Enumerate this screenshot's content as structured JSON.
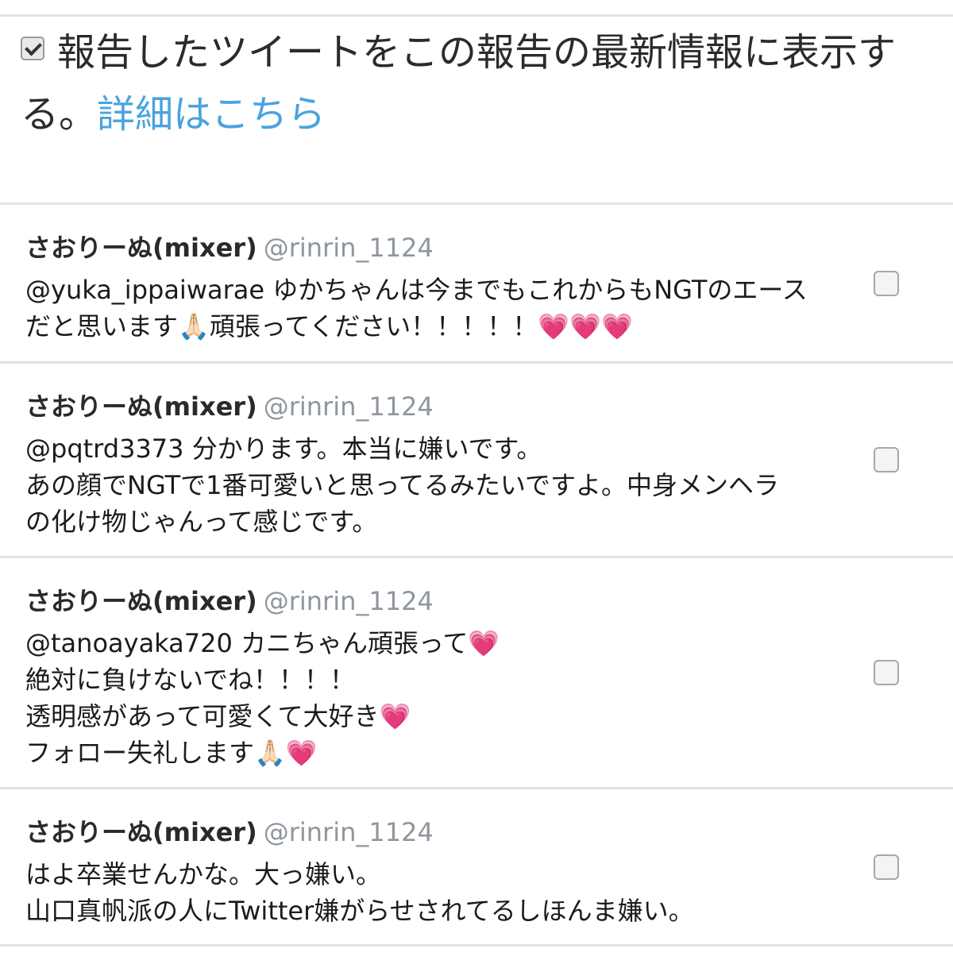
{
  "option": {
    "checked": true,
    "text": "報告したツイートをこの報告の最新情報に表示する。",
    "link": "詳細はこちら"
  },
  "tweets": [
    {
      "name": "さおりーぬ(mixer)",
      "handle": "@rinrin_1124",
      "text": "@yuka_ippaiwarae ゆかちゃんは今までもこれからもNGTのエース\nだと思います🙏🏻頑張ってください！！！！！💗💗💗"
    },
    {
      "name": "さおりーぬ(mixer)",
      "handle": "@rinrin_1124",
      "text": "@pqtrd3373 分かります。本当に嫌いです。\nあの顔でNGTで1番可愛いと思ってるみたいですよ。中身メンヘラ\nの化け物じゃんって感じです。"
    },
    {
      "name": "さおりーぬ(mixer)",
      "handle": "@rinrin_1124",
      "text": "@tanoayaka720 カニちゃん頑張って💗\n絶対に負けないでね！！！！\n透明感があって可愛くて大好き💗\nフォロー失礼します🙏🏻💗"
    },
    {
      "name": "さおりーぬ(mixer)",
      "handle": "@rinrin_1124",
      "text": "はよ卒業せんかな。大っ嫌い。\n山口真帆派の人にTwitter嫌がらせされてるしほんま嫌い。"
    }
  ]
}
